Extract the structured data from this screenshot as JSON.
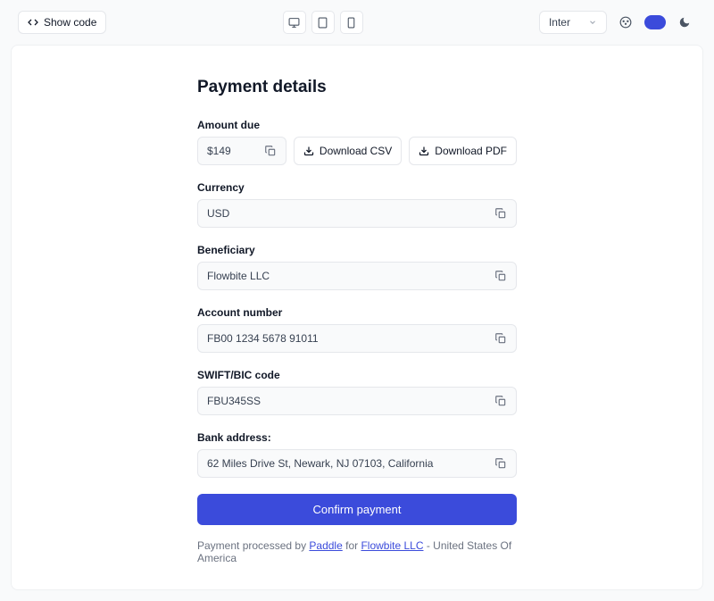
{
  "toolbar": {
    "show_code": "Show code",
    "font": "Inter"
  },
  "title": "Payment details",
  "amount": {
    "label": "Amount due",
    "value": "$149"
  },
  "download_csv": "Download CSV",
  "download_pdf": "Download PDF",
  "currency": {
    "label": "Currency",
    "value": "USD"
  },
  "beneficiary": {
    "label": "Beneficiary",
    "value": "Flowbite LLC"
  },
  "account": {
    "label": "Account number",
    "value": "FB00 1234 5678 91011"
  },
  "swift": {
    "label": "SWIFT/BIC code",
    "value": "FBU345SS"
  },
  "bank": {
    "label": "Bank address:",
    "value": "62 Miles Drive St, Newark, NJ 07103, California"
  },
  "confirm": "Confirm payment",
  "footer": {
    "prefix": "Payment processed by ",
    "link1": "Paddle",
    "mid": " for ",
    "link2": "Flowbite LLC",
    "suffix": " - United States Of America"
  }
}
